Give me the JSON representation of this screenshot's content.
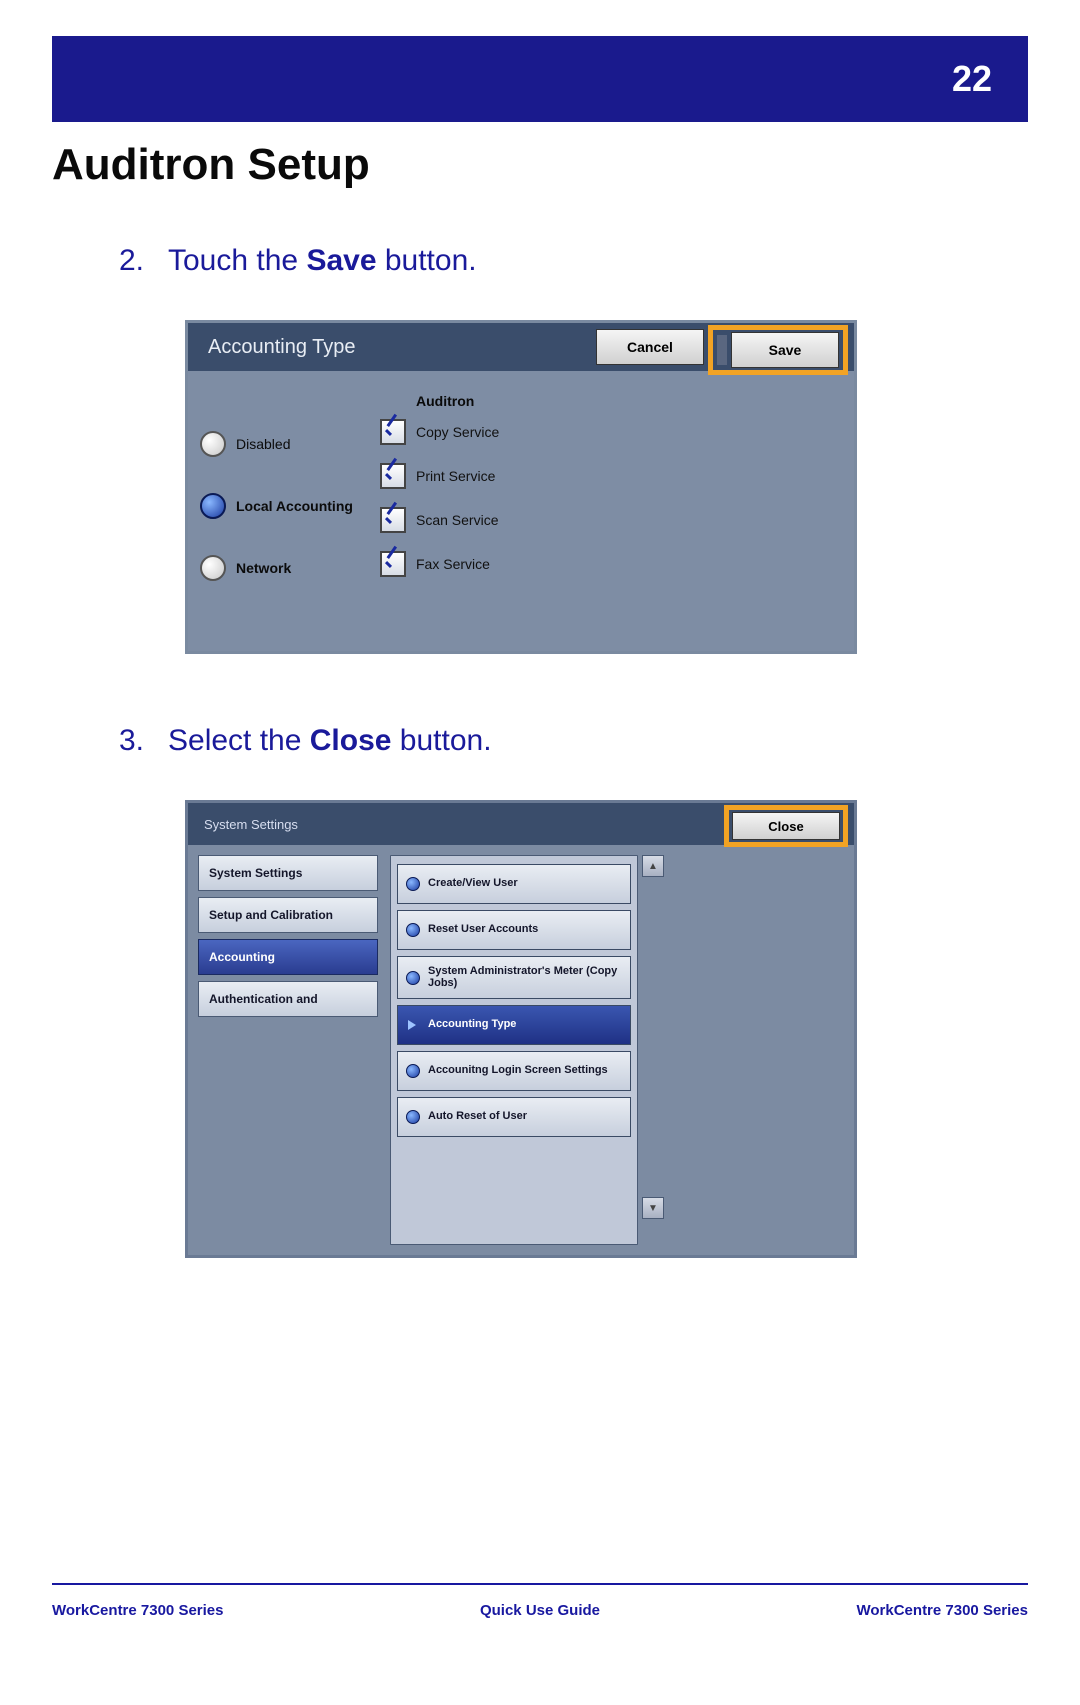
{
  "page": {
    "number": "22",
    "title": "Auditron Setup"
  },
  "steps": [
    {
      "num": "2.",
      "pre": "Touch the ",
      "bold": "Save",
      "post": " button."
    },
    {
      "num": "3.",
      "pre": "Select the ",
      "bold": "Close",
      "post": " button."
    }
  ],
  "shotA": {
    "title": "Accounting Type",
    "cancel": "Cancel",
    "save": "Save",
    "auditron_header": "Auditron",
    "radios": {
      "disabled": "Disabled",
      "local": "Local Accounting",
      "network": "Network"
    },
    "checks": {
      "copy": "Copy Service",
      "print": "Print Service",
      "scan": "Scan Service",
      "fax": "Fax Service"
    }
  },
  "shotB": {
    "title": "System Settings",
    "close": "Close",
    "tabs": {
      "sys": "System Settings",
      "setup": "Setup and Calibration",
      "acct": "Accounting",
      "auth": "Authentication and"
    },
    "items": {
      "create": "Create/View User",
      "reset": "Reset User Accounts",
      "admin": "System Administrator's Meter (Copy Jobs)",
      "acct_type": "Accounting Type",
      "login": "Accounitng Login Screen Settings",
      "autoreset": "Auto Reset of User"
    },
    "scroll_up": "▲",
    "scroll_down": "▼"
  },
  "footer": {
    "left": "WorkCentre 7300 Series",
    "mid": "Quick Use Guide",
    "right": "WorkCentre 7300 Series"
  }
}
